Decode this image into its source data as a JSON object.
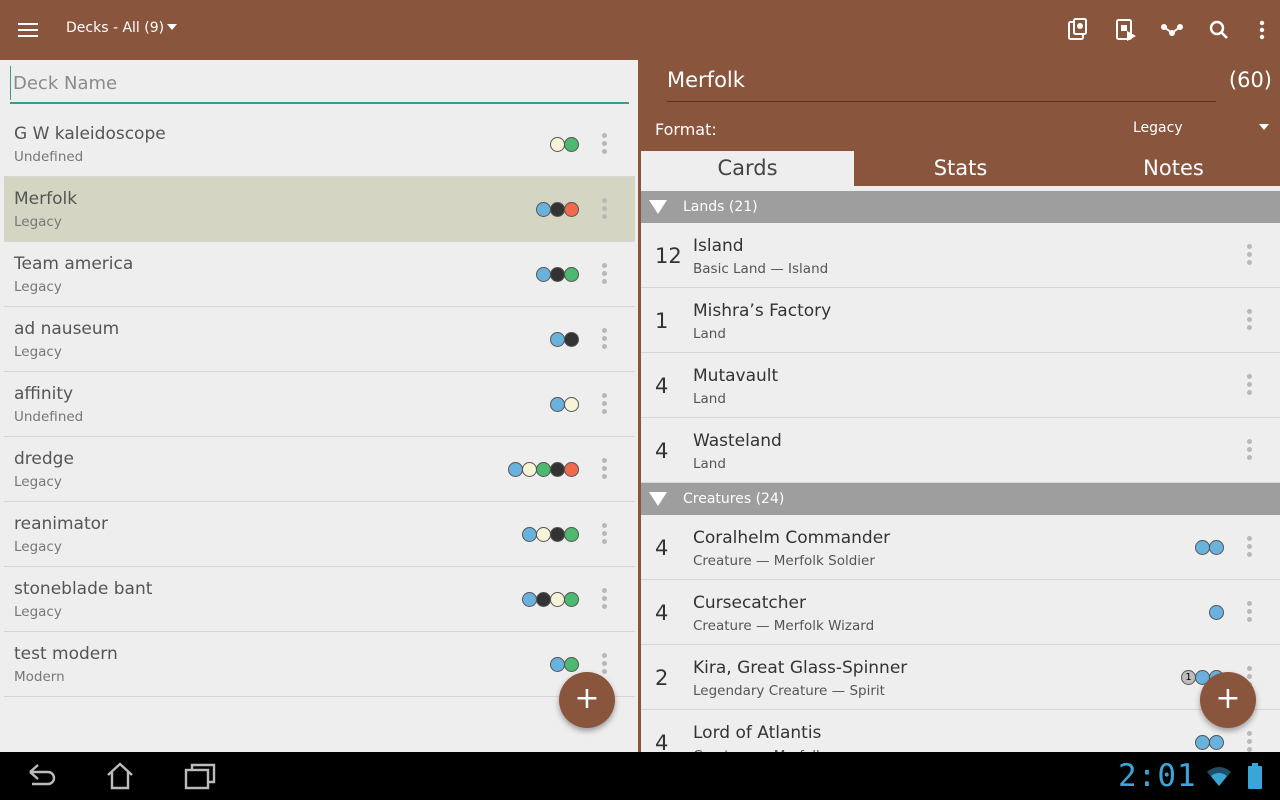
{
  "topbar": {
    "deck_filter": "Decks - All (9)",
    "actions": [
      "add-card-icon",
      "playtest-icon",
      "share-icon",
      "search-icon",
      "more-vert-icon"
    ]
  },
  "left": {
    "search_placeholder": "Deck Name",
    "decks": [
      {
        "name": "G W kaleidoscope",
        "format": "Undefined",
        "colors": [
          "#f7f3d6",
          "#4cb870"
        ]
      },
      {
        "name": "Merfolk",
        "format": "Legacy",
        "colors": [
          "#6ab2de",
          "#333333",
          "#ef6a4c"
        ],
        "selected": true
      },
      {
        "name": "Team america",
        "format": "Legacy",
        "colors": [
          "#6ab2de",
          "#333333",
          "#4cb870"
        ]
      },
      {
        "name": "ad nauseum",
        "format": "Legacy",
        "colors": [
          "#6ab2de",
          "#333333"
        ]
      },
      {
        "name": "affinity",
        "format": "Undefined",
        "colors": [
          "#6ab2de",
          "#f7f3d6"
        ]
      },
      {
        "name": "dredge",
        "format": "Legacy",
        "colors": [
          "#6ab2de",
          "#f7f3d6",
          "#4cb870",
          "#333333",
          "#ef6a4c"
        ]
      },
      {
        "name": "reanimator",
        "format": "Legacy",
        "colors": [
          "#6ab2de",
          "#f7f3d6",
          "#333333",
          "#4cb870"
        ]
      },
      {
        "name": "stoneblade bant",
        "format": "Legacy",
        "colors": [
          "#6ab2de",
          "#333333",
          "#f7f3d6",
          "#4cb870"
        ]
      },
      {
        "name": "test modern",
        "format": "Modern",
        "colors": [
          "#6ab2de",
          "#4cb870"
        ]
      }
    ],
    "fab": "+"
  },
  "right": {
    "deck_name": "Merfolk",
    "count": "(60)",
    "format_label": "Format:",
    "format_value": "Legacy",
    "tabs": [
      "Cards",
      "Stats",
      "Notes"
    ],
    "sections": [
      {
        "title": "Lands (21)",
        "cards": [
          {
            "qty": "12",
            "name": "Island",
            "type": "Basic Land — Island",
            "mana": []
          },
          {
            "qty": "1",
            "name": "Mishra’s Factory",
            "type": "Land",
            "mana": []
          },
          {
            "qty": "4",
            "name": "Mutavault",
            "type": "Land",
            "mana": []
          },
          {
            "qty": "4",
            "name": "Wasteland",
            "type": "Land",
            "mana": []
          }
        ]
      },
      {
        "title": "Creatures (24)",
        "cards": [
          {
            "qty": "4",
            "name": "Coralhelm Commander",
            "type": "Creature  — Merfolk Soldier",
            "mana": [
              "#6ab2de",
              "#6ab2de"
            ]
          },
          {
            "qty": "4",
            "name": "Cursecatcher",
            "type": "Creature  — Merfolk Wizard",
            "mana": [
              "#6ab2de"
            ]
          },
          {
            "qty": "2",
            "name": "Kira, Great Glass-Spinner",
            "type": "Legendary Creature  — Spirit",
            "mana": [
              "1",
              "#6ab2de",
              "#6ab2de"
            ]
          },
          {
            "qty": "4",
            "name": "Lord of Atlantis",
            "type": "Creature  — Merfolk",
            "mana": [
              "#6ab2de",
              "#6ab2de"
            ]
          }
        ]
      }
    ],
    "fab": "+"
  },
  "system": {
    "clock": "2:01"
  }
}
